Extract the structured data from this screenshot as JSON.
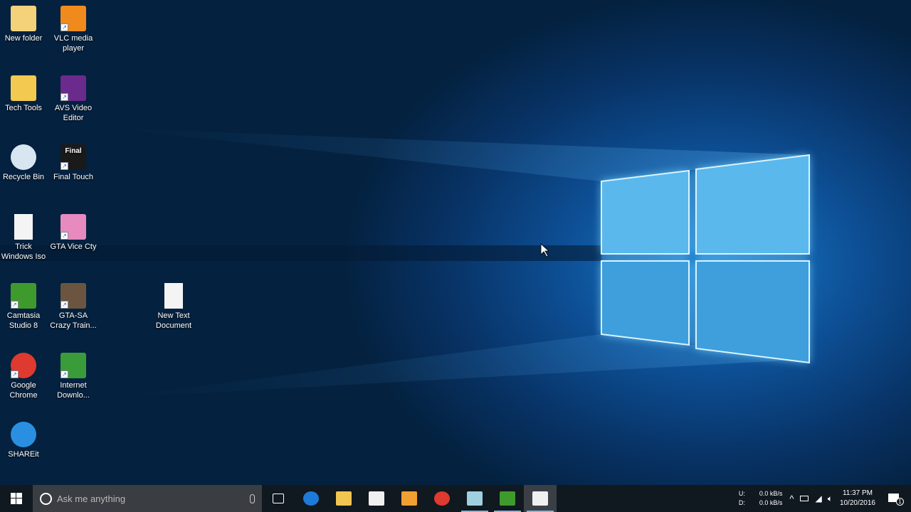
{
  "desktop_icons": [
    {
      "label": "New folder",
      "icon": "folder-icon",
      "color": "#f3d27a"
    },
    {
      "label": "VLC media player",
      "icon": "vlc-icon",
      "color": "#f08a1c"
    },
    {
      "label": "Tech Tools",
      "icon": "folder-icon",
      "color": "#f3c94f"
    },
    {
      "label": "AVS Video Editor",
      "icon": "avs-icon",
      "color": "#6a2b8c"
    },
    {
      "label": "Recycle Bin",
      "icon": "recycle-bin-icon",
      "color": "#d8e6f2"
    },
    {
      "label": "Final Touch",
      "icon": "final-touch-icon",
      "color": "#1a1a1a"
    },
    {
      "label": "Trick Windows Iso",
      "icon": "file-icon",
      "color": "#f4f4f4"
    },
    {
      "label": "GTA Vice Cty",
      "icon": "gta-vice-city-icon",
      "color": "#e68ac0"
    },
    {
      "label": "Camtasia Studio 8",
      "icon": "camtasia-icon",
      "color": "#3f9a2e"
    },
    {
      "label": "GTA-SA Crazy Train...",
      "icon": "gta-sa-icon",
      "color": "#6b5540"
    },
    {
      "label": "Google Chrome",
      "icon": "chrome-icon",
      "color": "#de3a2f"
    },
    {
      "label": "Internet Downlo...",
      "icon": "idm-icon",
      "color": "#3a9b3a"
    },
    {
      "label": "SHAREit",
      "icon": "shareit-icon",
      "color": "#2a8fe0"
    },
    {
      "label": "New Text Document",
      "icon": "text-file-icon",
      "color": "#f4f4f4"
    }
  ],
  "final_touch_text": "Final",
  "taskbar": {
    "search_placeholder": "Ask me anything",
    "apps": [
      {
        "name": "task-view",
        "color": "#101820"
      },
      {
        "name": "edge",
        "color": "#1e7ad8"
      },
      {
        "name": "file-explorer",
        "color": "#f1c550"
      },
      {
        "name": "store",
        "color": "#f0f0f0"
      },
      {
        "name": "app-orange",
        "color": "#f0a030"
      },
      {
        "name": "chrome",
        "color": "#de3a2f"
      },
      {
        "name": "notepad-app",
        "color": "#9fd0e0"
      },
      {
        "name": "camtasia",
        "color": "#3f9a2e"
      },
      {
        "name": "camtasia-recorder",
        "color": "#f0f0f0"
      }
    ],
    "net_up_label": "U:",
    "net_down_label": "D:",
    "net_up": "0.0 kB/s",
    "net_down": "0.0 kB/s",
    "time": "11:37 PM",
    "date": "10/20/2016",
    "notification_count": "1"
  }
}
